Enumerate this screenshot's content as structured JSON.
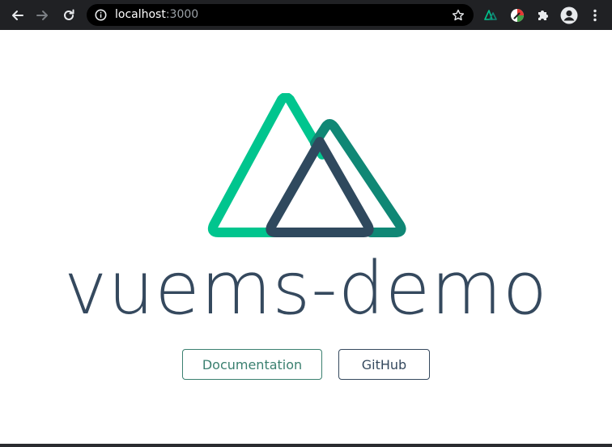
{
  "browser": {
    "url_host": "localhost",
    "url_port": ":3000",
    "icons": [
      "back-icon",
      "forward-icon",
      "reload-icon",
      "info-icon",
      "star-icon",
      "nuxt-extension-icon",
      "color-extension-icon",
      "puzzle-icon",
      "profile-icon",
      "more-icon"
    ]
  },
  "page": {
    "title": "vuems-demo",
    "buttons": {
      "docs_label": "Documentation",
      "github_label": "GitHub"
    }
  },
  "colors": {
    "nuxt_green": "#00C58E",
    "nuxt_dark_green": "#108775",
    "nuxt_navy": "#2F495E",
    "text_navy": "#35495e",
    "docs_green": "#3b8070",
    "toolbar_bg": "#202124",
    "omnibox_bg": "#000000"
  }
}
